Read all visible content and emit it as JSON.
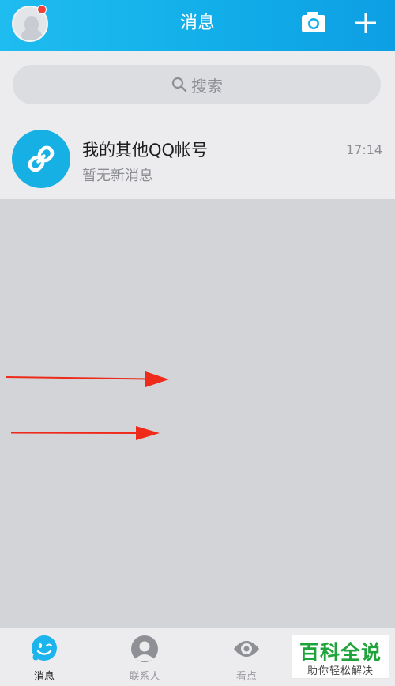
{
  "header": {
    "title": "消息",
    "avatar_icon": "penguin-avatar-icon",
    "left_icons": [
      "notification-dot-icon"
    ],
    "right_icons": [
      "camera-icon",
      "plus-icon"
    ]
  },
  "search": {
    "placeholder": "搜索",
    "icon": "search-icon"
  },
  "messages": [
    {
      "name": "我的其他QQ帐号",
      "preview": "暂无新消息",
      "time": "17:14",
      "icon": "link-icon"
    }
  ],
  "tabs": [
    {
      "label": "消息",
      "icon": "qq-smile-icon",
      "active": true
    },
    {
      "label": "联系人",
      "icon": "contact-person-icon",
      "active": false
    },
    {
      "label": "看点",
      "icon": "eye-icon",
      "active": false
    },
    {
      "label": "",
      "icon": "dynamic-icon",
      "active": false
    }
  ],
  "annotations": {
    "arrow_color": "#ee2a1b",
    "count": 2
  },
  "watermark": {
    "title": "百科全说",
    "subtitle": "助你轻松解决"
  },
  "colors": {
    "header_start": "#1fbcf0",
    "header_end": "#0d9fe3",
    "background": "#d3d4d8",
    "accent": "#16b0e4",
    "badge": "#f0423a",
    "watermark_green": "#1ea43a"
  }
}
